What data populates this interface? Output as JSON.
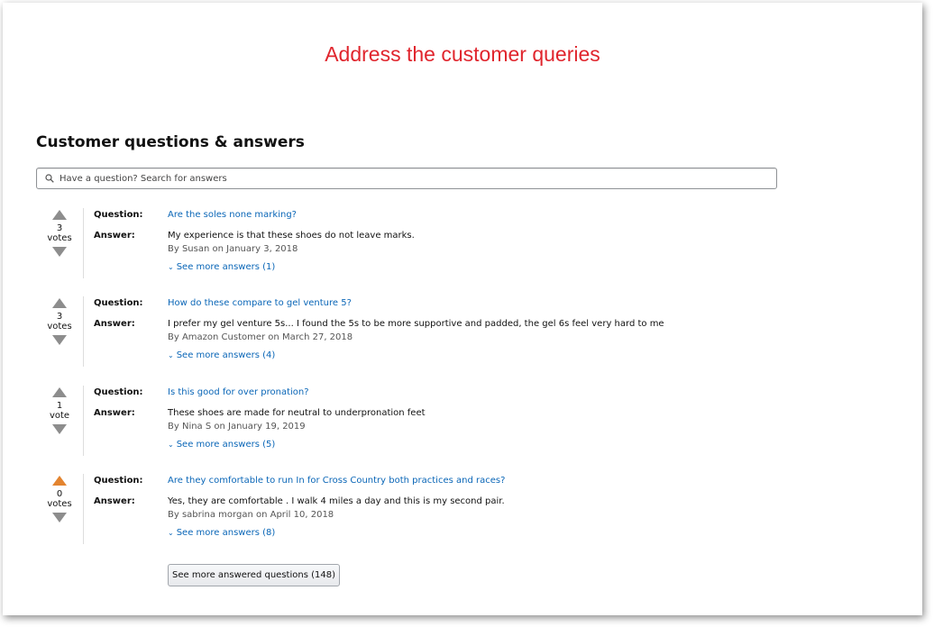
{
  "headline": "Address the customer queries",
  "section_title": "Customer questions & answers",
  "search": {
    "placeholder": "Have a question? Search for answers",
    "icon": "search-icon"
  },
  "labels": {
    "question": "Question:",
    "answer": "Answer:"
  },
  "qa_items": [
    {
      "votes": "3",
      "vote_label": "votes",
      "upvote_active": false,
      "question": "Are the soles none marking?",
      "answer": "My experience is that these shoes do not leave marks.",
      "byline": "By Susan on January 3, 2018",
      "more": "See more answers (1)"
    },
    {
      "votes": "3",
      "vote_label": "votes",
      "upvote_active": false,
      "question": "How do these compare to gel venture 5?",
      "answer": "I prefer my gel venture 5s... I found the 5s to be more supportive and padded, the gel 6s feel very hard to me",
      "byline": "By Amazon Customer on March 27, 2018",
      "more": "See more answers (4)"
    },
    {
      "votes": "1",
      "vote_label": "vote",
      "upvote_active": false,
      "question": "Is this good for over pronation?",
      "answer": "These shoes are made for neutral to underpronation feet",
      "byline": "By Nina S on January 19, 2019",
      "more": "See more answers (5)"
    },
    {
      "votes": "0",
      "vote_label": "votes",
      "upvote_active": true,
      "question": "Are they comfortable to run In for Cross Country both practices and races?",
      "answer": "Yes, they are comfortable . I walk 4 miles a day and this is my second pair.",
      "byline": "By sabrina morgan on April 10, 2018",
      "more": "See more answers (8)"
    }
  ],
  "see_more_button": "See more answered questions (148)",
  "colors": {
    "headline": "#e0252d",
    "link": "#0a66b7",
    "vote_arrow": "#8d8d8d",
    "vote_arrow_active": "#e3842f"
  }
}
